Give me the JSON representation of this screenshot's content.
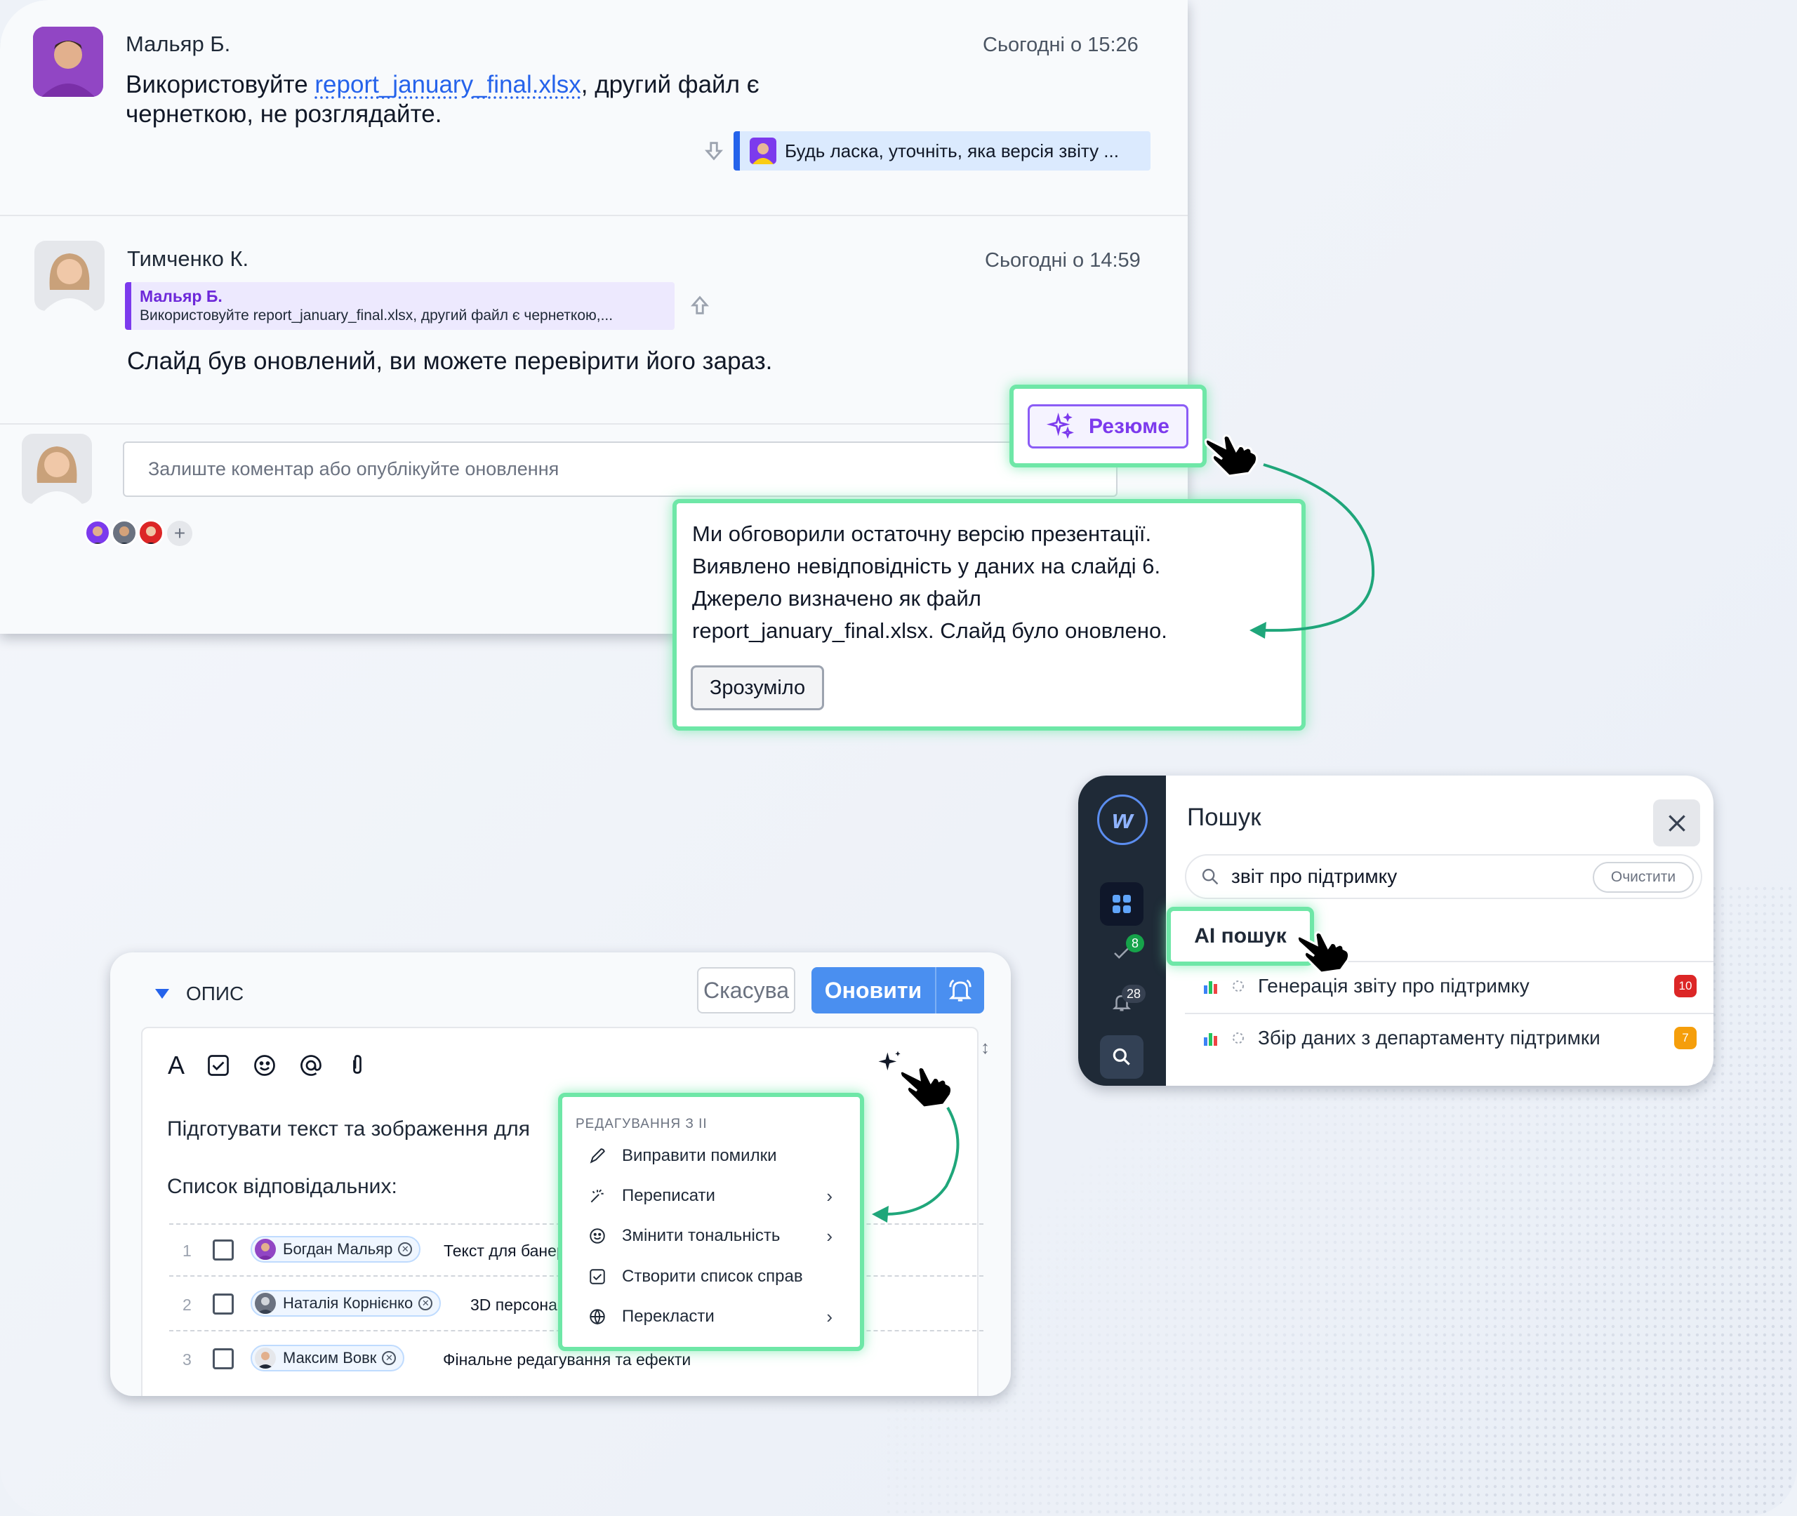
{
  "chat": {
    "messages": [
      {
        "author": "Мальяр Б.",
        "time": "Сьогодні о 15:26",
        "text_before": "Використовуйте ",
        "link": "report_january_final.xlsx",
        "text_after": ", другий файл є",
        "text_line2": "чернеткою, не розглядайте.",
        "reply_preview": "Будь ласка, уточніть, яка версія звіту ..."
      },
      {
        "author": "Тимченко К.",
        "time": "Сьогодні о 14:59",
        "quote_author": "Мальяр Б.",
        "quote_text": "Використовуйте report_january_final.xlsx, другий файл є чернеткою,...",
        "text": "Слайд був оновлений, ви можете перевірити його зараз."
      }
    ],
    "comment_placeholder": "Залиште коментар або опублікуйте оновлення",
    "add_participant": "+"
  },
  "summary": {
    "button_label": "Резюме",
    "lines": [
      "Ми обговорили остаточну версію презентації.",
      "Виявлено невідповідність у даних на слайді 6.",
      "Джерело визначено як файл",
      "report_january_final.xlsx. Слайд було оновлено."
    ],
    "ok_label": "Зрозуміло"
  },
  "search": {
    "title": "Пошук",
    "query": "звіт про підтримку",
    "clear_label": "Очистити",
    "ai_label": "AI пошук",
    "tasks_badge": "8",
    "notifications_badge": "28",
    "results": [
      {
        "title": "Генерація звіту про підтримку",
        "count": "10",
        "color": "#dc2626"
      },
      {
        "title": "Збір даних з департаменту підтримки",
        "count": "7",
        "color": "#f59e0b"
      }
    ]
  },
  "editor": {
    "section_label": "ОПИС",
    "cancel_label": "Скасува",
    "update_label": "Оновити",
    "text_line1": "Підготувати текст та зображення для",
    "text_line2": "Список відповідальних:",
    "rows": [
      {
        "num": "1",
        "assignee": "Богдан Мальяр",
        "task": "Текст для банер"
      },
      {
        "num": "2",
        "assignee": "Наталія Корнієнко",
        "task": "3D персона"
      },
      {
        "num": "3",
        "assignee": "Максим Вовк",
        "task": "Фінальне редагування та ефекти"
      }
    ],
    "ai_menu": {
      "header": "РЕДАГУВАННЯ З ІІ",
      "items": [
        {
          "label": "Виправити помилки",
          "icon": "pen-icon"
        },
        {
          "label": "Переписати",
          "icon": "magic-wand-icon",
          "submenu": true
        },
        {
          "label": "Змінити тональність",
          "icon": "smile-icon",
          "submenu": true
        },
        {
          "label": "Створити список справ",
          "icon": "checkbox-icon"
        },
        {
          "label": "Перекласти",
          "icon": "globe-icon",
          "submenu": true
        }
      ]
    }
  },
  "colors": {
    "accent_green": "#6ee7a7",
    "brand_blue": "#4a8ff0",
    "ai_purple": "#7c3aed",
    "arrow_green": "#1fa67a"
  }
}
